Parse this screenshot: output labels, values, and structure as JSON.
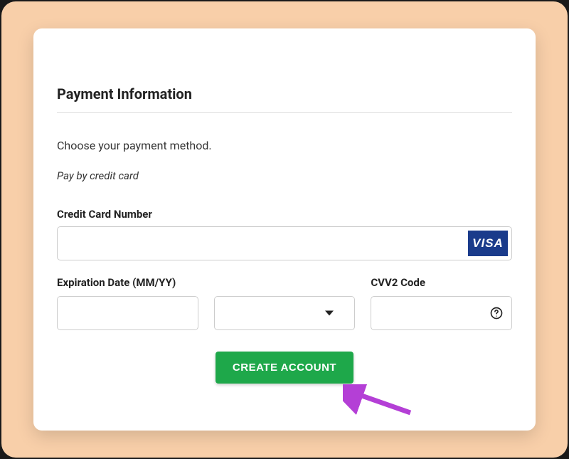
{
  "section": {
    "title": "Payment Information",
    "instruction": "Choose your payment method.",
    "subnote": "Pay by credit card"
  },
  "fields": {
    "card_number": {
      "label": "Credit Card Number",
      "value": "",
      "badge": "VISA"
    },
    "exp_date": {
      "label": "Expiration Date (MM/YY)",
      "value": ""
    },
    "exp_select": {
      "value": ""
    },
    "cvv": {
      "label": "CVV2 Code",
      "value": ""
    }
  },
  "button": {
    "create_label": "CREATE ACCOUNT"
  },
  "colors": {
    "accent": "#1ea84a",
    "visa": "#1a3b8b",
    "arrow": "#b43fd6"
  }
}
